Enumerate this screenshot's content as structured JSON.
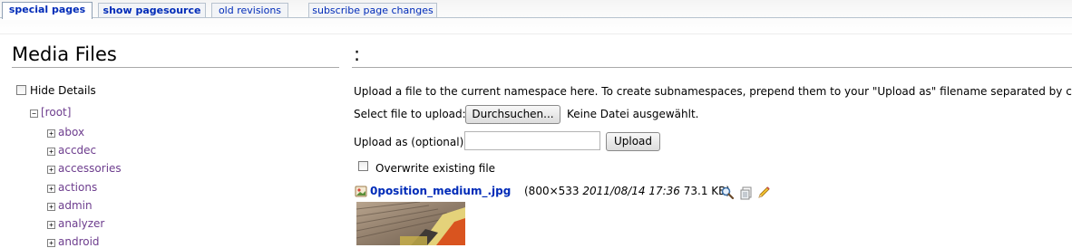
{
  "tabs": [
    {
      "label": "special pages",
      "active": true
    },
    {
      "label": "show pagesource",
      "active": false
    },
    {
      "label": "old revisions",
      "active": false
    },
    {
      "label": "subscribe page changes",
      "active": false
    }
  ],
  "left": {
    "title": "Media Files",
    "hide_details": "Hide Details",
    "root": "[root]",
    "namespaces": [
      "abox",
      "accdec",
      "accessories",
      "actions",
      "admin",
      "analyzer",
      "android"
    ]
  },
  "right": {
    "title": ":",
    "upload_info": "Upload a file to the current namespace here. To create subnamespaces, prepend them to your \"Upload as\" filename separated by colons.",
    "select_label": "Select file to upload:",
    "browse_button": "Durchsuchen...",
    "no_file": "Keine Datei ausgewählt.",
    "upload_as_label": "Upload as (optional):",
    "upload_as_value": "",
    "upload_button": "Upload",
    "overwrite_label": "Overwrite existing file",
    "file": {
      "name": "0position_medium_.jpg",
      "meta_open": "(800×533 ",
      "date": "2011/08/14 17:36",
      "meta_close": " 73.1 KB)"
    }
  },
  "colors": {
    "link": "#002bb8",
    "namespace_link": "#6d3d8e",
    "tab_border": "#b8c3cf"
  }
}
